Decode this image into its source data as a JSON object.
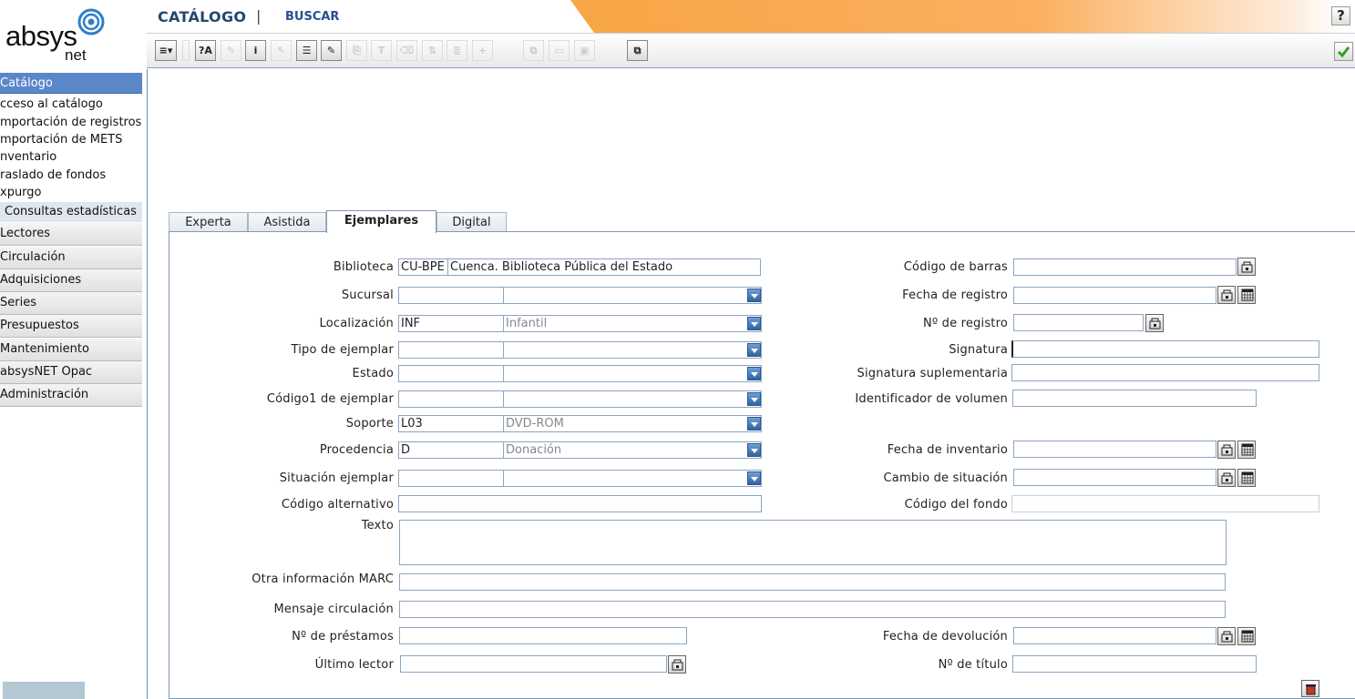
{
  "brand": {
    "word": "absys",
    "sub": "net"
  },
  "sidebar": {
    "active_section": "Catálogo",
    "items": [
      "cceso al catálogo",
      "mportación de registros",
      "mportación de METS",
      "nventario",
      "raslado de fondos",
      "xpurgo"
    ],
    "sub_item": "Consultas estadísticas",
    "sections": [
      "Lectores",
      "Circulación",
      "Adquisiciones",
      "Series",
      "Presupuestos",
      "Mantenimiento",
      "absysNET Opac",
      "Administración"
    ]
  },
  "header": {
    "title": "CATÁLOGO",
    "separator": "|",
    "link": "BUSCAR",
    "help": "?"
  },
  "toolbar": {
    "icons": [
      "list-menu-icon",
      "spellcheck-icon",
      "wand-icon",
      "info-icon",
      "cursor-icon",
      "record-icon",
      "edit-icon",
      "copy-icon",
      "format-icon",
      "delete-icon",
      "sort-icon",
      "merge-icon",
      "add-icon",
      "duplicate-icon",
      "print-icon",
      "paste-icon",
      "export-icon"
    ],
    "confirm_icon": "checkmark-icon"
  },
  "tabs": [
    {
      "label": "Experta"
    },
    {
      "label": "Asistida"
    },
    {
      "label": "Ejemplares"
    },
    {
      "label": "Digital"
    }
  ],
  "form": {
    "biblioteca": {
      "label": "Biblioteca",
      "code": "CU-BPE",
      "name": "Cuenca. Biblioteca Pública del Estado"
    },
    "sucursal": {
      "label": "Sucursal",
      "code": "",
      "name": ""
    },
    "localizacion": {
      "label": "Localización",
      "code": "INF",
      "name": "Infantil"
    },
    "tipo": {
      "label": "Tipo de ejemplar",
      "code": "",
      "name": ""
    },
    "estado": {
      "label": "Estado",
      "code": "",
      "name": ""
    },
    "codigo1": {
      "label": "Código1 de ejemplar",
      "code": "",
      "name": ""
    },
    "soporte": {
      "label": "Soporte",
      "code": "L03",
      "name": "DVD-ROM"
    },
    "procedencia": {
      "label": "Procedencia",
      "code": "D",
      "name": "Donación"
    },
    "situacion": {
      "label": "Situación ejemplar",
      "code": "",
      "name": ""
    },
    "codigo_alt": {
      "label": "Código alternativo",
      "value": ""
    },
    "texto": {
      "label": "Texto",
      "value": ""
    },
    "otra_info": {
      "label": "Otra información MARC",
      "value": ""
    },
    "mensaje": {
      "label": "Mensaje circulación",
      "value": ""
    },
    "prestamos": {
      "label": "Nº de préstamos",
      "value": ""
    },
    "ultimo": {
      "label": "Último lector",
      "value": ""
    },
    "codigo_barras": {
      "label": "Código de barras",
      "value": ""
    },
    "fecha_registro": {
      "label": "Fecha de registro",
      "value": ""
    },
    "num_registro": {
      "label": "Nº de registro",
      "value": ""
    },
    "signatura": {
      "label": "Signatura",
      "value": ""
    },
    "signatura_supl": {
      "label": "Signatura suplementaria",
      "value": ""
    },
    "id_volumen": {
      "label": "Identificador de volumen",
      "value": ""
    },
    "fecha_inventario": {
      "label": "Fecha de inventario",
      "value": ""
    },
    "cambio_situacion": {
      "label": "Cambio de situación",
      "value": ""
    },
    "codigo_fondo": {
      "label": "Código del fondo",
      "value": ""
    },
    "fecha_devolucion": {
      "label": "Fecha de devolución",
      "value": ""
    },
    "num_titulo": {
      "label": "Nº de título",
      "value": ""
    }
  }
}
